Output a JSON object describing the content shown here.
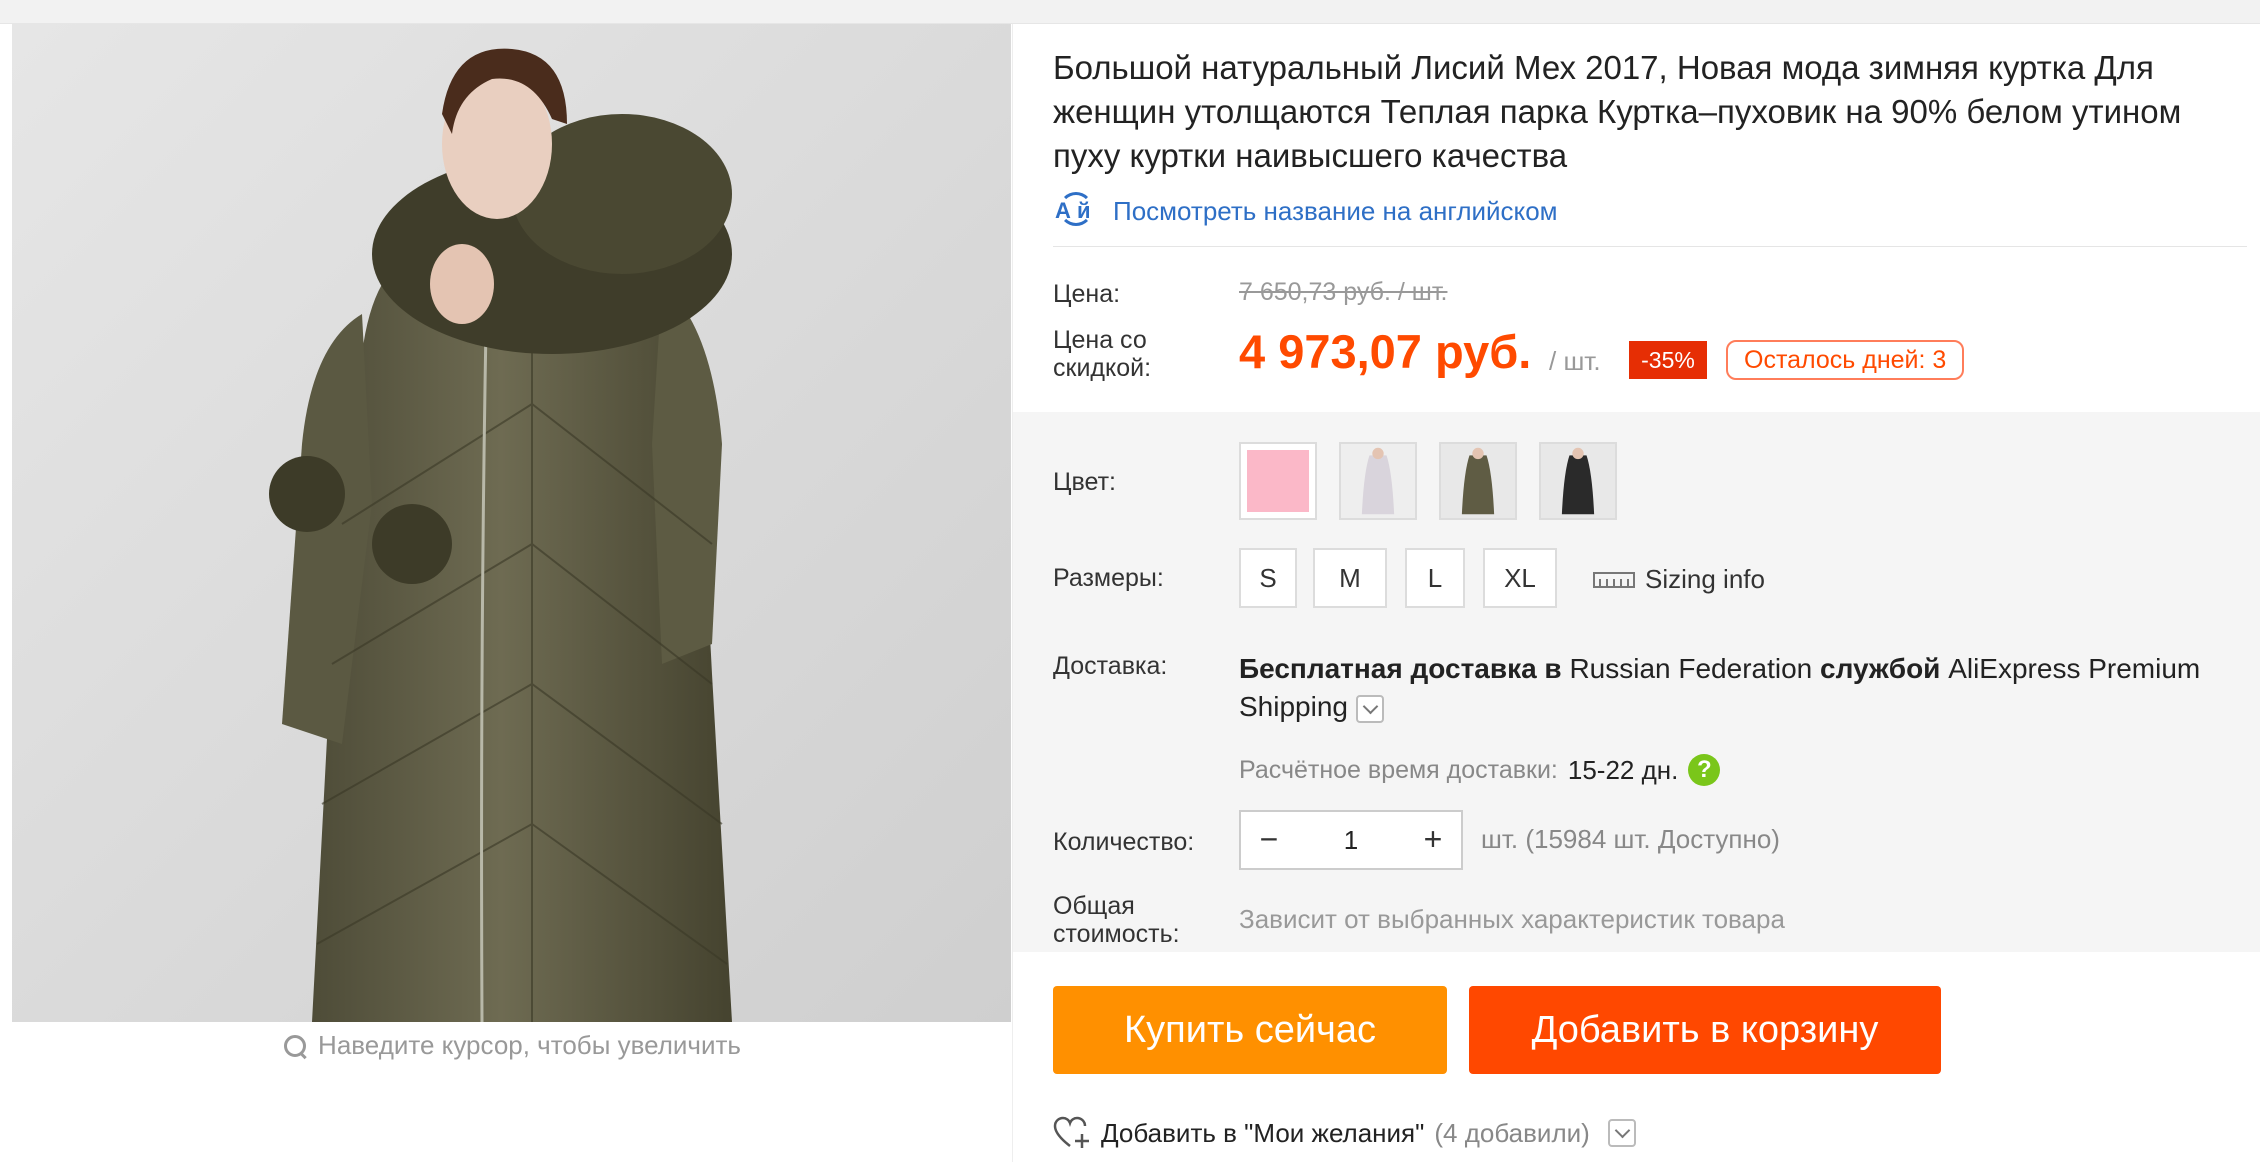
{
  "product": {
    "title": "Большой натуральный Лисий Мех 2017, Новая мода зимняя куртка Для женщин утолщаются Теплая парка Куртка–пуховик на 90% белом утином пуху куртки наивысшего качества",
    "translate_link": "Посмотреть название на английском",
    "translate_icon": "translate-icon",
    "zoom_hint": "Наведите курсор, чтобы увеличить"
  },
  "price": {
    "label": "Цена:",
    "original": "7 650,73 руб. / шт.",
    "discount_label": "Цена со скидкой:",
    "current": "4 973,07 руб.",
    "unit": "/ шт.",
    "discount_badge": "-35%",
    "days_left": "Осталось дней: 3",
    "accent_color": "#ff4a00"
  },
  "options": {
    "color_label": "Цвет:",
    "colors": [
      {
        "name": "pink",
        "swatch": "#fbb8c8"
      },
      {
        "name": "light-coat-photo"
      },
      {
        "name": "olive-coat-photo"
      },
      {
        "name": "black-coat-photo"
      }
    ],
    "sizes_label": "Размеры:",
    "sizes": [
      "S",
      "M",
      "L",
      "XL"
    ],
    "sizing_info": "Sizing info"
  },
  "delivery": {
    "label": "Доставка:",
    "free_text": "Бесплатная доставка в",
    "country": "Russian Federation",
    "via": "службой",
    "service": "AliExpress Premium Shipping",
    "eta_label": "Расчётное время доставки:",
    "eta_value": "15-22 дн."
  },
  "quantity": {
    "label": "Количество:",
    "value": "1",
    "minus": "−",
    "plus": "+",
    "available": "шт. (15984 шт. Доступно)"
  },
  "total": {
    "label": "Общая стоимость:",
    "value": "Зависит от выбранных характеристик товара"
  },
  "actions": {
    "buy_now": "Купить сейчас",
    "add_to_cart": "Добавить в корзину",
    "wishlist": "Добавить в \"Мои желания\"",
    "wishlist_count": "(4 добавили)",
    "buy_color": "#ff9000",
    "cart_color": "#ff4800"
  }
}
